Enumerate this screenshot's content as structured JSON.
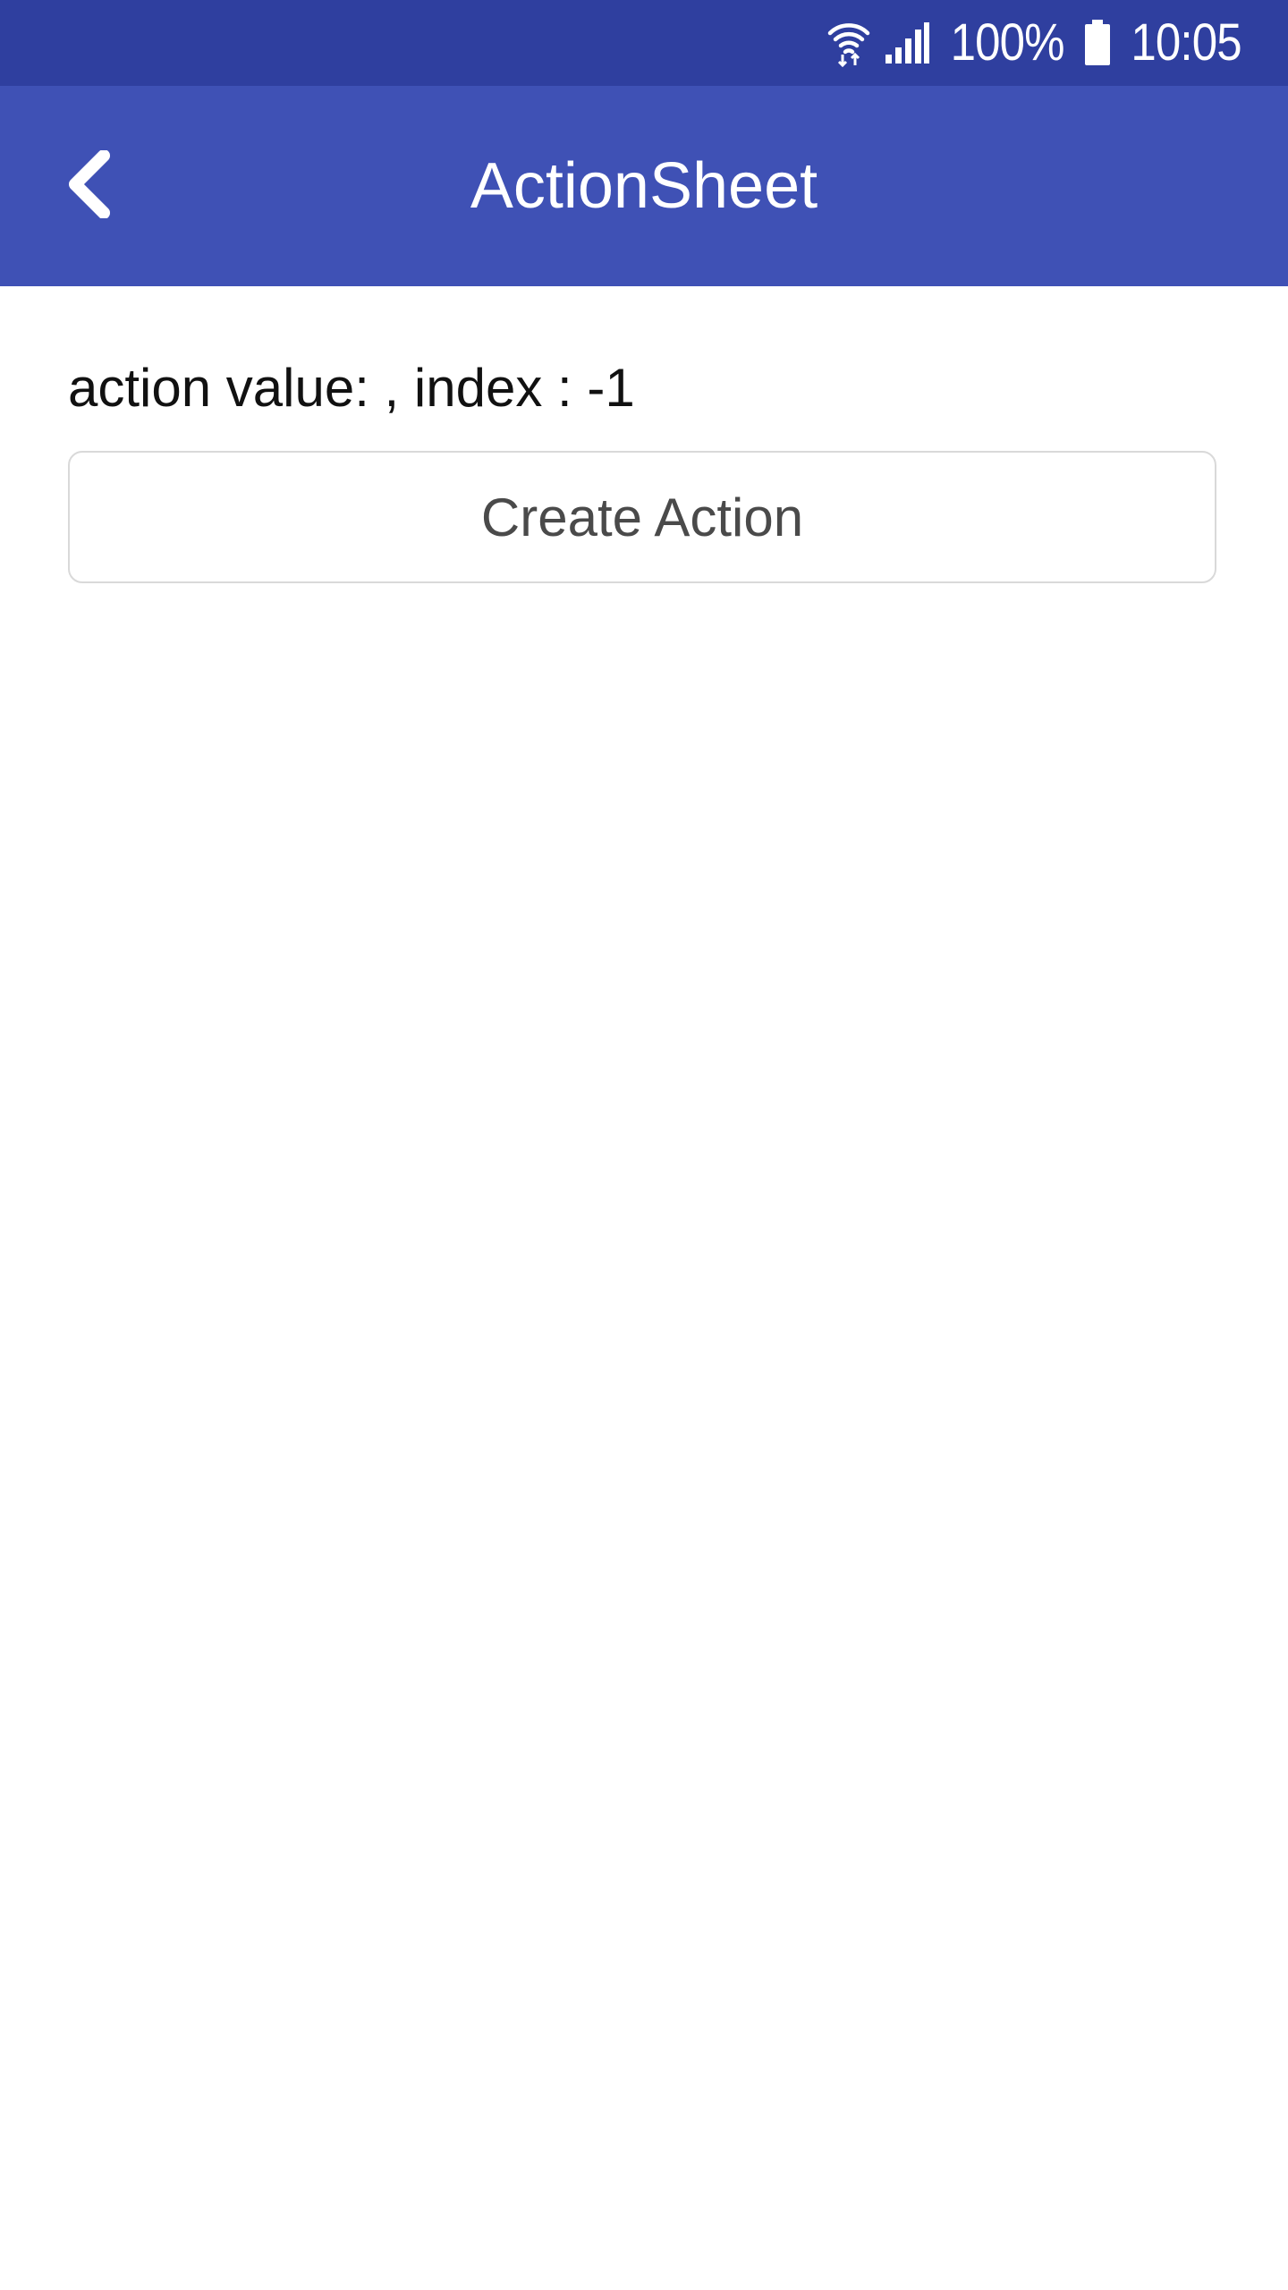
{
  "status_bar": {
    "battery_percent": "100%",
    "time": "10:05",
    "icons": [
      "wifi-icon",
      "signal-icon",
      "battery-icon"
    ],
    "background_color": "#2f3f9f"
  },
  "app_bar": {
    "title": "ActionSheet",
    "back_icon": "chevron-left-icon",
    "background_color": "#3f51b5"
  },
  "main": {
    "result_text": "action value: , index : -1",
    "create_button_label": "Create Action"
  }
}
